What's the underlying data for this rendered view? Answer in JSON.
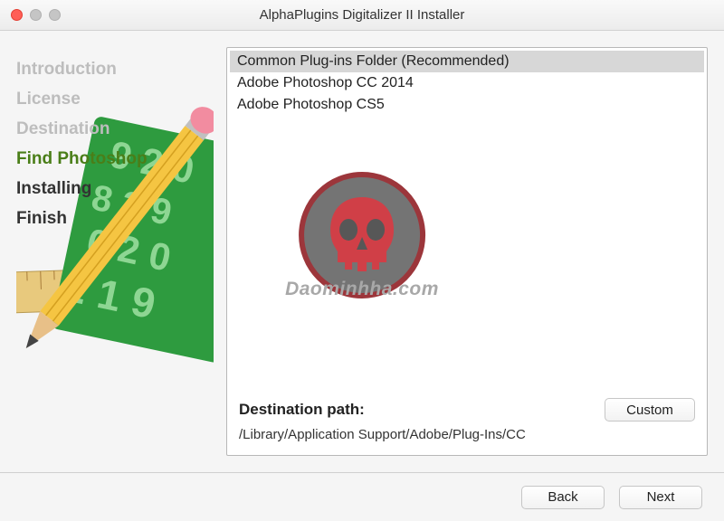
{
  "window": {
    "title": "AlphaPlugins Digitalizer II Installer"
  },
  "sidebar": {
    "steps": [
      {
        "label": "Introduction",
        "state": "done"
      },
      {
        "label": "License",
        "state": "done"
      },
      {
        "label": "Destination",
        "state": "done"
      },
      {
        "label": "Find Photoshop",
        "state": "current"
      },
      {
        "label": "Installing",
        "state": "upcoming"
      },
      {
        "label": "Finish",
        "state": "upcoming"
      }
    ]
  },
  "list": {
    "items": [
      {
        "label": "Common Plug-ins Folder (Recommended)",
        "selected": true
      },
      {
        "label": "Adobe Photoshop CC 2014",
        "selected": false
      },
      {
        "label": "Adobe Photoshop CS5",
        "selected": false
      }
    ]
  },
  "destination": {
    "label": "Destination path:",
    "path": "/Library/Application Support/Adobe/Plug-Ins/CC",
    "custom_button": "Custom"
  },
  "footer": {
    "back": "Back",
    "next": "Next"
  },
  "watermark": {
    "text": "Daominhha.com"
  }
}
